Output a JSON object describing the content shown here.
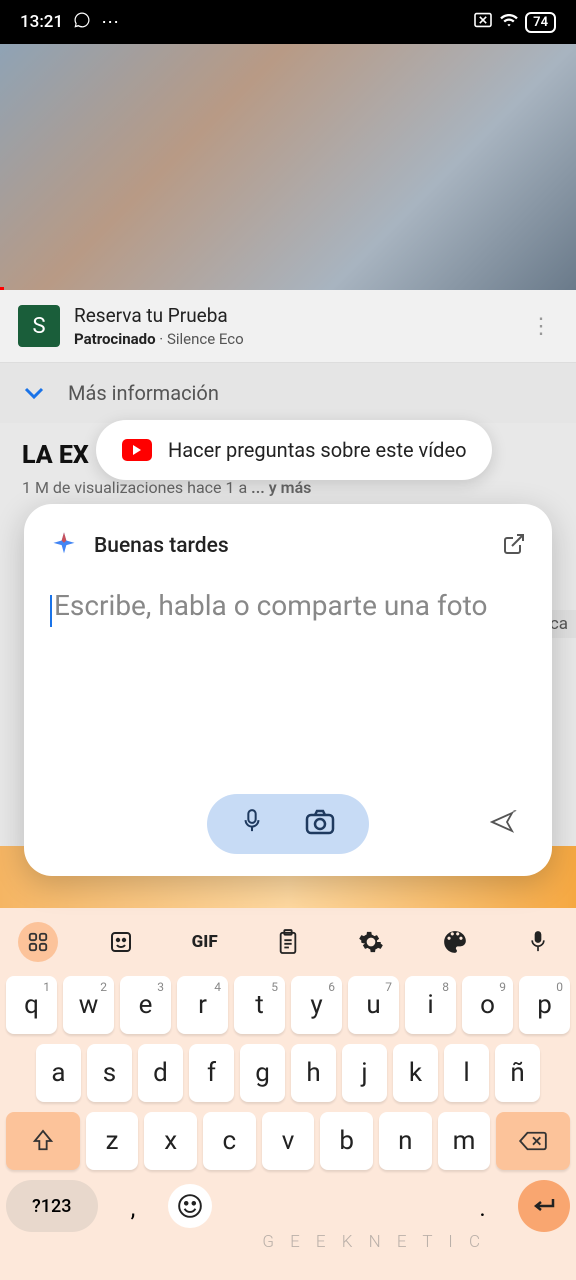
{
  "status": {
    "time": "13:21",
    "battery": "74"
  },
  "ad": {
    "avatar_letter": "S",
    "title": "Reserva tu Prueba",
    "sponsored": "Patrocinado",
    "sponsor": "Silence Eco"
  },
  "more_info": "Más información",
  "video": {
    "title": "LA EX",
    "views": "1 M de visualizaciones  hace 1 a",
    "more": "... y más"
  },
  "suggestion": {
    "text": "Hacer preguntas sobre este vídeo"
  },
  "sca": "sca",
  "assistant": {
    "greeting": "Buenas tardes",
    "placeholder": "Escribe, habla o comparte una foto"
  },
  "keyboard": {
    "gif": "GIF",
    "row1": [
      {
        "k": "q",
        "n": "1"
      },
      {
        "k": "w",
        "n": "2"
      },
      {
        "k": "e",
        "n": "3"
      },
      {
        "k": "r",
        "n": "4"
      },
      {
        "k": "t",
        "n": "5"
      },
      {
        "k": "y",
        "n": "6"
      },
      {
        "k": "u",
        "n": "7"
      },
      {
        "k": "i",
        "n": "8"
      },
      {
        "k": "o",
        "n": "9"
      },
      {
        "k": "p",
        "n": "0"
      }
    ],
    "row2": [
      "a",
      "s",
      "d",
      "f",
      "g",
      "h",
      "j",
      "k",
      "l",
      "ñ"
    ],
    "row3": [
      "z",
      "x",
      "c",
      "v",
      "b",
      "n",
      "m"
    ],
    "k123": "?123",
    "comma": ",",
    "dot": "."
  },
  "watermark": "G E E K N E T I C"
}
